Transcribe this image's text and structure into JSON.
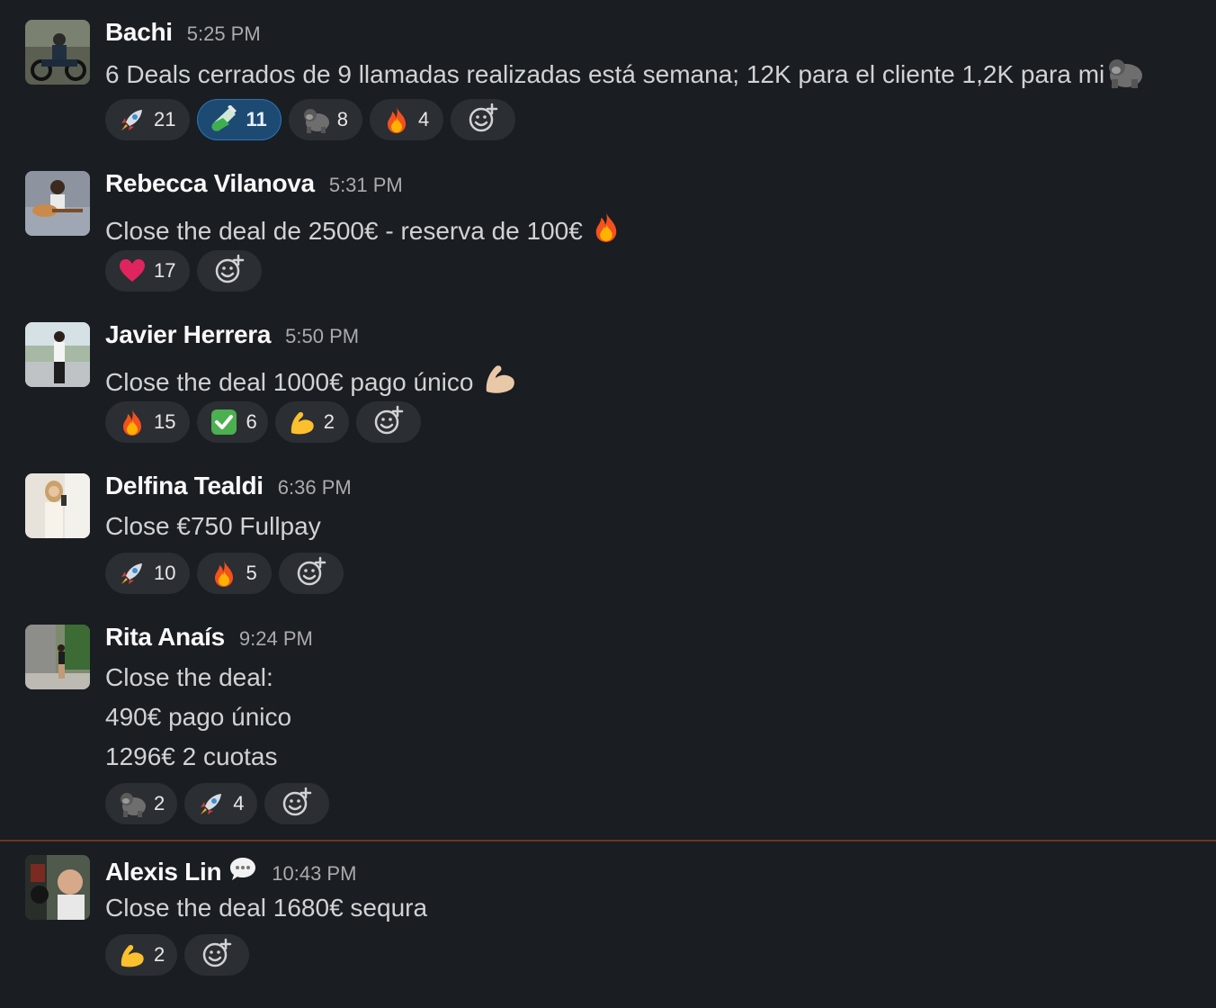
{
  "messages": [
    {
      "author": "Bachi",
      "time": "5:25 PM",
      "lines": [
        "6 Deals cerrados de 9 llamadas realizadas está semana; 12K para el cliente 1,2K para mi"
      ],
      "trailing_emoji": "gorilla",
      "reactions": [
        {
          "emoji": "rocket",
          "count": "21",
          "active": false
        },
        {
          "emoji": "test-tube",
          "count": "11",
          "active": true
        },
        {
          "emoji": "gorilla",
          "count": "8",
          "active": false
        },
        {
          "emoji": "fire",
          "count": "4",
          "active": false
        }
      ]
    },
    {
      "author": "Rebecca Vilanova",
      "time": "5:31 PM",
      "lines": [
        "Close the deal de 2500€ - reserva de 100€"
      ],
      "trailing_emoji": "fire",
      "reactions": [
        {
          "emoji": "heart",
          "count": "17",
          "active": false
        }
      ]
    },
    {
      "author": "Javier Herrera",
      "time": "5:50 PM",
      "lines": [
        "Close the deal  1000€ pago único"
      ],
      "trailing_emoji": "muscle-light",
      "reactions": [
        {
          "emoji": "fire",
          "count": "15",
          "active": false
        },
        {
          "emoji": "check",
          "count": "6",
          "active": false
        },
        {
          "emoji": "muscle",
          "count": "2",
          "active": false
        }
      ]
    },
    {
      "author": "Delfina Tealdi",
      "time": "6:36 PM",
      "lines": [
        "Close €750 Fullpay"
      ],
      "reactions": [
        {
          "emoji": "rocket",
          "count": "10",
          "active": false
        },
        {
          "emoji": "fire",
          "count": "5",
          "active": false
        }
      ]
    },
    {
      "author": "Rita Anaís",
      "time": "9:24 PM",
      "lines": [
        "Close the deal:",
        "490€ pago único",
        "1296€ 2 cuotas"
      ],
      "reactions": [
        {
          "emoji": "gorilla",
          "count": "2",
          "active": false
        },
        {
          "emoji": "rocket",
          "count": "4",
          "active": false
        }
      ]
    },
    {
      "author": "Alexis Lin",
      "status_icon": "speech-bubble",
      "time": "10:43 PM",
      "lines": [
        "Close the deal 1680€ sequra"
      ],
      "reactions": [
        {
          "emoji": "muscle",
          "count": "2",
          "active": false
        }
      ]
    }
  ],
  "colors": {
    "background": "#1a1d21",
    "reaction_bg": "#2b2e33",
    "reaction_active_bg": "#1d4a73",
    "new_messages_divider": "#6a3523"
  }
}
